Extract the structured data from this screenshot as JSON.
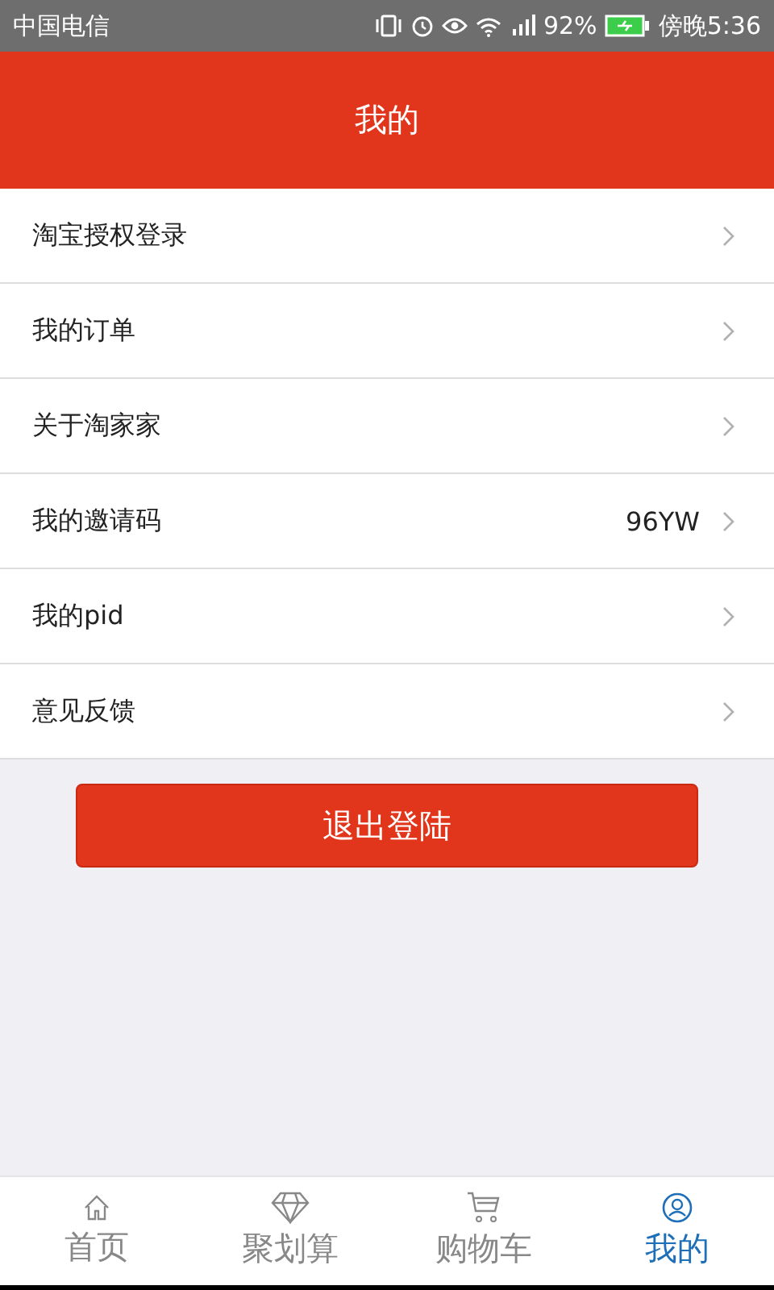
{
  "status_bar": {
    "carrier": "中国电信",
    "battery_percent": "92%",
    "time": "傍晚5:36"
  },
  "header": {
    "title": "我的"
  },
  "menu": [
    {
      "label": "淘宝授权登录"
    },
    {
      "label": "我的订单"
    },
    {
      "label": "关于淘家家"
    },
    {
      "label": "我的邀请码",
      "value": "96YW"
    },
    {
      "label": "我的pid"
    },
    {
      "label": "意见反馈"
    }
  ],
  "logout_button": "退出登陆",
  "tabs": [
    {
      "label": "首页",
      "kind": "home",
      "selected": false
    },
    {
      "label": "聚划算",
      "kind": "diamond",
      "selected": false
    },
    {
      "label": "购物车",
      "kind": "cart",
      "selected": false
    },
    {
      "label": "我的",
      "kind": "profile",
      "selected": true
    }
  ]
}
